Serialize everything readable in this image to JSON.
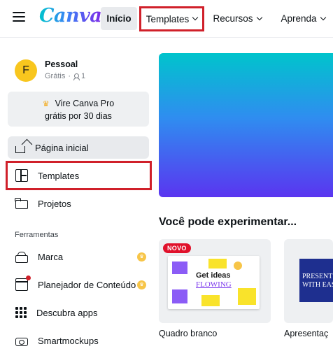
{
  "header": {
    "logo": "Canva",
    "nav": {
      "home": "Início",
      "templates": "Templates",
      "resources": "Recursos",
      "learn": "Aprenda"
    }
  },
  "account": {
    "avatar_initial": "F",
    "name": "Pessoal",
    "plan": "Grátis",
    "members": "1"
  },
  "promo": {
    "line1": "Vire Canva Pro",
    "line2": "grátis por 30 dias"
  },
  "sidebar": {
    "items": [
      {
        "label": "Página inicial",
        "icon": "home-icon"
      },
      {
        "label": "Templates",
        "icon": "templates-icon"
      },
      {
        "label": "Projetos",
        "icon": "folder-icon"
      }
    ],
    "tools_label": "Ferramentas",
    "tools": [
      {
        "label": "Marca",
        "icon": "brand-kit-icon",
        "pro": true
      },
      {
        "label": "Planejador de Conteúdo",
        "icon": "calendar-icon",
        "pro": true
      },
      {
        "label": "Descubra apps",
        "icon": "apps-icon",
        "pro": false
      },
      {
        "label": "Smartmockups",
        "icon": "mockups-icon",
        "pro": false
      }
    ]
  },
  "main": {
    "section_title": "Você pode experimentar...",
    "cards": [
      {
        "label": "Quadro branco",
        "badge": "NOVO",
        "thumb_line1": "Get ideas",
        "thumb_line2": "FLOWING"
      },
      {
        "label": "Apresentaç",
        "thumb_line1": "PRESENT",
        "thumb_line2": "WITH EAS"
      }
    ]
  },
  "colors": {
    "highlight": "#d0202a",
    "brand_gradient": [
      "#00c4cc",
      "#7d2ae8"
    ],
    "badge_new": "#e0112b",
    "pro_crown": "#f3a712"
  }
}
